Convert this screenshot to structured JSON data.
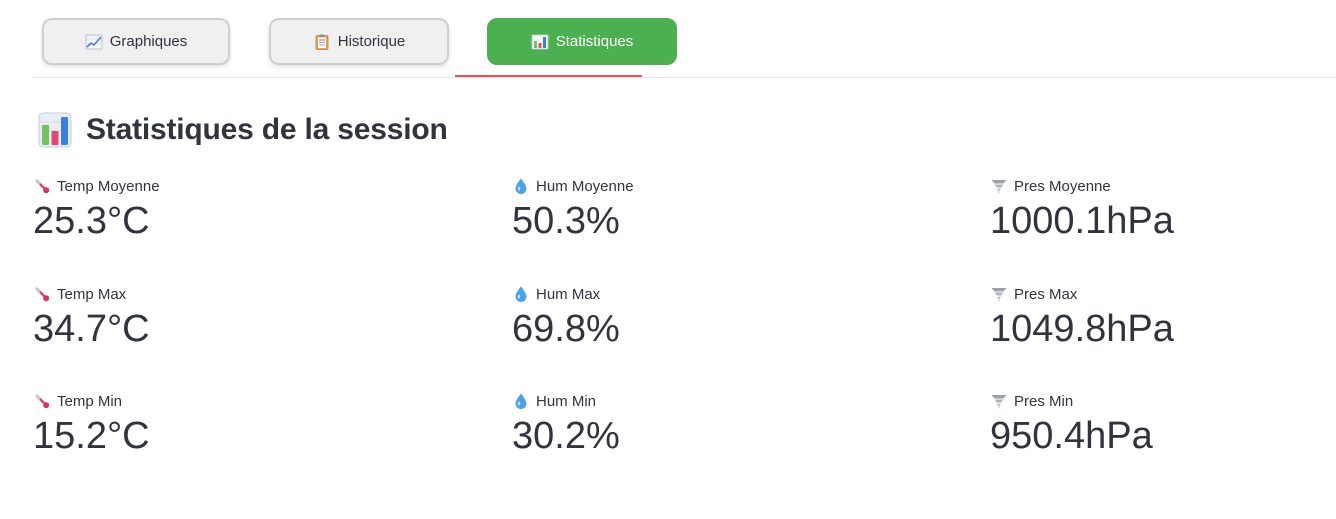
{
  "tabs": [
    {
      "label": "Graphiques",
      "icon": "chart-increasing-icon",
      "active": false
    },
    {
      "label": "Historique",
      "icon": "clipboard-icon",
      "active": false
    },
    {
      "label": "Statistiques",
      "icon": "bar-chart-icon",
      "active": true
    }
  ],
  "colors": {
    "active_tab": "#4caf50",
    "active_underline": "#ff4b4b",
    "text": "#31333f"
  },
  "section": {
    "title": "Statistiques de la session",
    "icon": "bar-chart-icon"
  },
  "metrics": {
    "temp": {
      "icon": "thermometer-icon",
      "avg": {
        "label": "Temp Moyenne",
        "value": "25.3°C"
      },
      "max": {
        "label": "Temp Max",
        "value": "34.7°C"
      },
      "min": {
        "label": "Temp Min",
        "value": "15.2°C"
      }
    },
    "hum": {
      "icon": "droplet-icon",
      "avg": {
        "label": "Hum Moyenne",
        "value": "50.3%"
      },
      "max": {
        "label": "Hum Max",
        "value": "69.8%"
      },
      "min": {
        "label": "Hum Min",
        "value": "30.2%"
      }
    },
    "pres": {
      "icon": "tornado-icon",
      "avg": {
        "label": "Pres Moyenne",
        "value": "1000.1hPa"
      },
      "max": {
        "label": "Pres Max",
        "value": "1049.8hPa"
      },
      "min": {
        "label": "Pres Min",
        "value": "950.4hPa"
      }
    }
  }
}
